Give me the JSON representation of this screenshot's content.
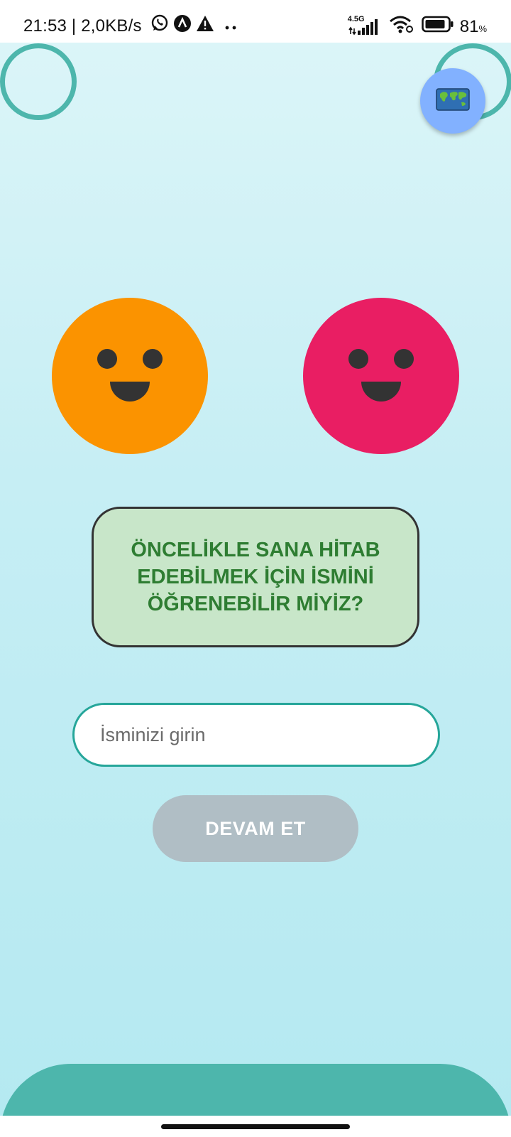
{
  "status_bar": {
    "time_and_speed": "21:53 | 2,0KB/s",
    "network_type": "4.5G",
    "battery_percent": "81",
    "battery_unit": "%",
    "icons": [
      "whatsapp-icon",
      "app-notification-icon",
      "warning-icon",
      "more-dots-icon",
      "signal-icon",
      "wifi-icon",
      "battery-icon"
    ]
  },
  "top_bar": {
    "map_button_icon": "world-map-icon",
    "map_button_emoji": "🗺️"
  },
  "faces": [
    {
      "color": "#fb9300"
    },
    {
      "color": "#e91e63"
    }
  ],
  "message": {
    "text": "ÖNCELİKLE SANA HİTAB EDEBİLMEK İÇİN İSMİNİ ÖĞRENEBİLİR MİYİZ?"
  },
  "name_input": {
    "placeholder": "İsminizi girin",
    "value": ""
  },
  "continue_button": {
    "label": "DEVAM ET",
    "enabled": false
  },
  "colors": {
    "accent": "#4db6ac",
    "message_bg": "#c8e6c9",
    "message_text": "#2e7d32",
    "button_disabled": "#b0bec5"
  }
}
